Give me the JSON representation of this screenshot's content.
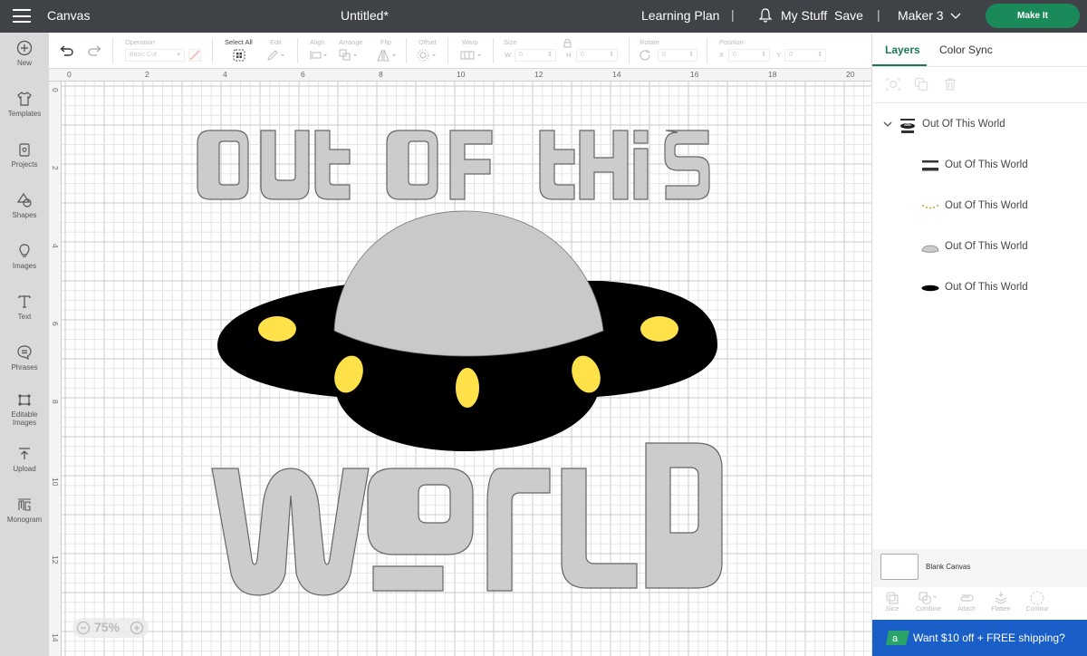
{
  "topbar": {
    "app_title": "Canvas",
    "doc_title": "Untitled*",
    "learning_plan": "Learning Plan",
    "separator": "|",
    "my_stuff": "My Stuff",
    "save": "Save",
    "machine": "Maker 3",
    "make_it": "Make It",
    "make_it_color": "#1b8a5a"
  },
  "leftnav": {
    "items": [
      {
        "label": "New",
        "icon": "plus-circle-icon"
      },
      {
        "label": "Templates",
        "icon": "shirt-icon"
      },
      {
        "label": "Projects",
        "icon": "projects-icon"
      },
      {
        "label": "Shapes",
        "icon": "shapes-icon"
      },
      {
        "label": "Images",
        "icon": "lightbulb-icon"
      },
      {
        "label": "Text",
        "icon": "text-icon"
      },
      {
        "label": "Phrases",
        "icon": "speech-bubble-icon"
      },
      {
        "label": "Editable",
        "label2": "Images",
        "icon": "editable-images-icon"
      },
      {
        "label": "Upload",
        "icon": "upload-icon"
      },
      {
        "label": "Monogram",
        "icon": "monogram-icon"
      }
    ]
  },
  "toolbar": {
    "operation_label": "Operation",
    "operation_value": "Basic Cut",
    "select_all": "Select All",
    "edit": "Edit",
    "align": "Align",
    "arrange": "Arrange",
    "flip": "Flip",
    "offset": "Offset",
    "warp": "Warp",
    "size": "Size",
    "w_label": "W",
    "h_label": "H",
    "w_value": "0",
    "h_value": "0",
    "rotate": "Rotate",
    "rotate_value": "0",
    "position": "Position",
    "x_label": "X",
    "y_label": "Y",
    "x_value": "0",
    "y_value": "0"
  },
  "canvas": {
    "ruler_h": [
      "0",
      "2",
      "4",
      "6",
      "8",
      "10",
      "12",
      "14",
      "16",
      "18",
      "20"
    ],
    "ruler_v": [
      "0",
      "2",
      "4",
      "6",
      "8",
      "10",
      "12",
      "14"
    ],
    "zoom_level": "75%",
    "design": {
      "line1": "OUt OF tHiS",
      "line2": "WoRLD",
      "letter_color": "#cccccc",
      "ufo_body_color": "#000000",
      "ufo_dome_color": "#c9c9c9",
      "ufo_light_color": "#ffe24a"
    }
  },
  "rightpanel": {
    "tabs": [
      "Layers",
      "Color Sync"
    ],
    "group_name": "Out Of This World",
    "layers": [
      {
        "name": "Out Of This World",
        "thumb": "text-thumb"
      },
      {
        "name": "Out Of This World",
        "thumb": "dots-thumb"
      },
      {
        "name": "Out Of This World",
        "thumb": "dome-thumb"
      },
      {
        "name": "Out Of This World",
        "thumb": "saucer-thumb"
      }
    ],
    "blank_canvas": "Blank Canvas",
    "bottom_tools": [
      "Slice",
      "Combine",
      "Attach",
      "Flatten",
      "Contour"
    ],
    "promo": "Want $10 off + FREE shipping?",
    "promo_color": "#1a5fc8"
  }
}
